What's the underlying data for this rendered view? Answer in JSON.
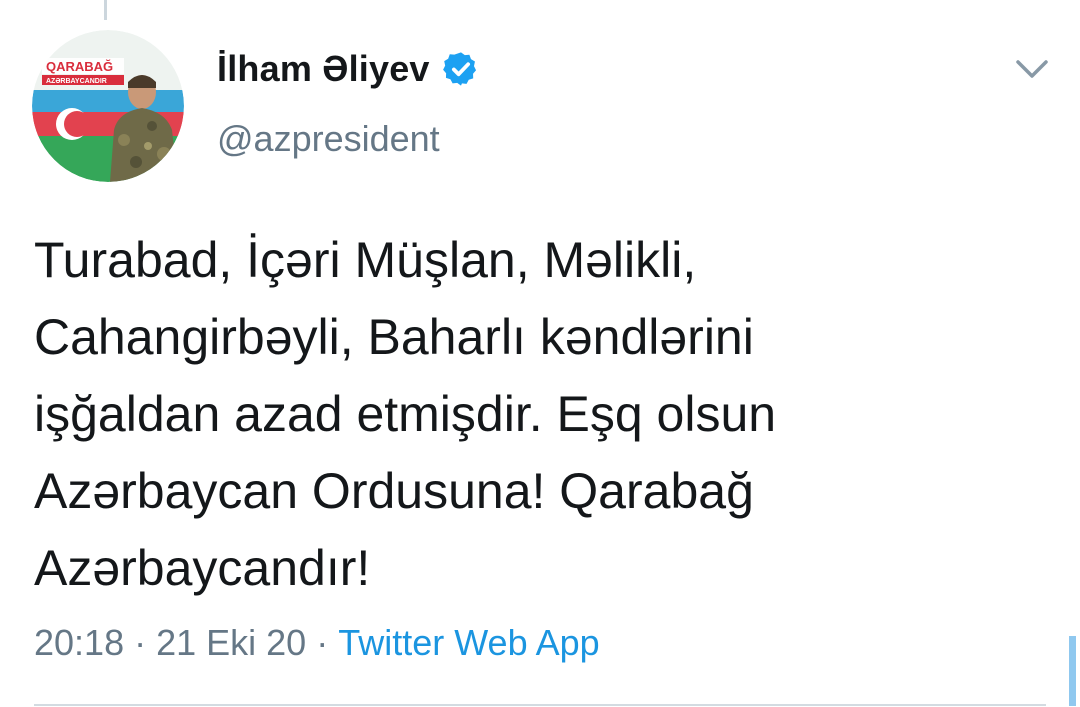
{
  "author": {
    "display_name": "İlham Əliyev",
    "handle": "@azpresident",
    "avatar_banner_line1": "QARABAĞ",
    "avatar_banner_line2": "AZƏRBAYCANDIR"
  },
  "tweet": {
    "text": "Turabad, İçəri Müşlan, Məlikli,\nCahangirbəyli, Baharlı kəndlərini\nişğaldan azad etmişdir. Eşq olsun\nAzərbaycan Ordusuna! Qarabağ\nAzərbaycandır!",
    "time": "20:18",
    "separator": "·",
    "date": "21 Eki 20",
    "source": "Twitter Web App"
  },
  "icons": {
    "verified": "verified-badge-icon",
    "menu": "chevron-down-icon"
  },
  "colors": {
    "text": "#14171a",
    "secondary": "#657786",
    "link": "#1b95e0",
    "verified": "#1da1f2"
  }
}
